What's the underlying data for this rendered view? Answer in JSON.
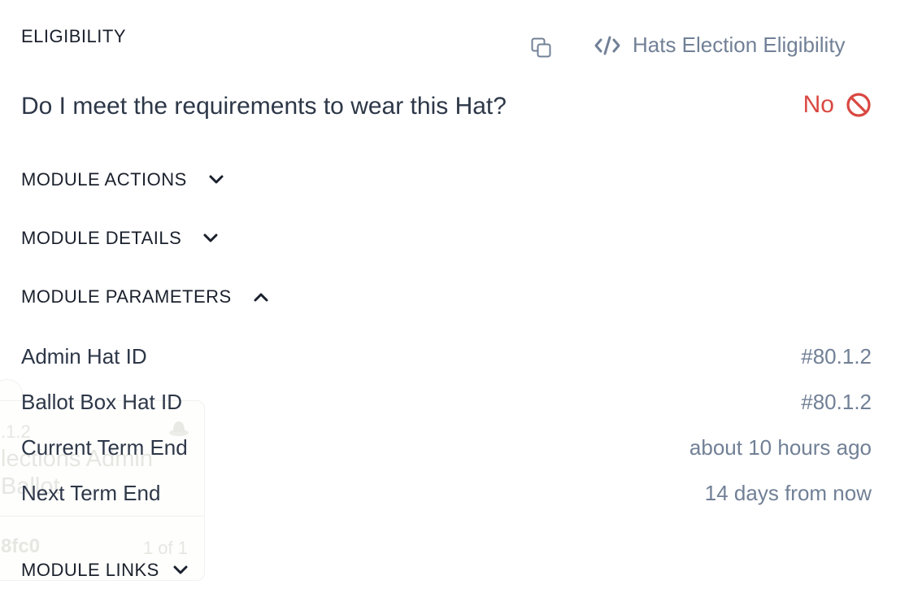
{
  "eligibility": {
    "title": "ELIGIBILITY",
    "copy_icon": "copy-icon",
    "module_link_icon": "code-icon",
    "module_name": "Hats Election Eligibility",
    "question": "Do I meet the requirements to wear this Hat?",
    "answer": "No",
    "answer_icon": "prohibited-icon",
    "answer_color": "#d94841"
  },
  "sections": {
    "module_actions": {
      "label": "MODULE ACTIONS",
      "expanded": false
    },
    "module_details": {
      "label": "MODULE DETAILS",
      "expanded": false
    },
    "module_parameters": {
      "label": "MODULE PARAMETERS",
      "expanded": true
    },
    "module_links": {
      "label": "MODULE LINKS",
      "expanded": false
    }
  },
  "parameters": [
    {
      "label": "Admin Hat ID",
      "value": "#80.1.2"
    },
    {
      "label": "Ballot Box Hat ID",
      "value": "#80.1.2"
    },
    {
      "label": "Current Term End",
      "value": "about 10 hours ago"
    },
    {
      "label": "Next Term End",
      "value": "14 days from now"
    }
  ],
  "background_card": {
    "hat_id": ".1.2",
    "name_line1": "lections Admin",
    "name_line2": "Ballot",
    "address": "8fc0",
    "count": "1 of 1"
  },
  "colors": {
    "text_primary": "#2d3748",
    "text_muted": "#718096",
    "danger": "#d94841"
  }
}
